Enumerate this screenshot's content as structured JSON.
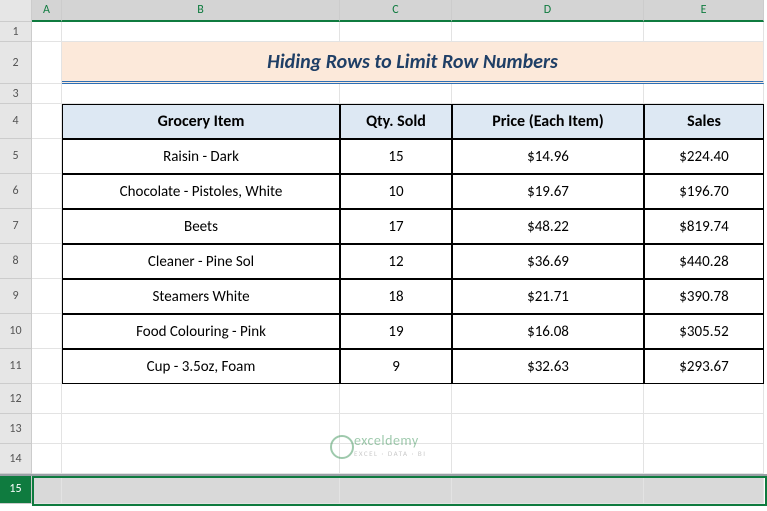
{
  "columns": [
    "A",
    "B",
    "C",
    "D",
    "E"
  ],
  "row_numbers": [
    1,
    2,
    3,
    4,
    5,
    6,
    7,
    8,
    9,
    10,
    11,
    12,
    13,
    14,
    15
  ],
  "selected_row": 15,
  "title": "Hiding Rows to Limit Row Numbers",
  "headers": {
    "item": "Grocery Item",
    "qty": "Qty. Sold",
    "price": "Price (Each Item)",
    "sales": "Sales"
  },
  "data": [
    {
      "item": "Raisin - Dark",
      "qty": "15",
      "price": "$14.96",
      "sales": "$224.40"
    },
    {
      "item": "Chocolate - Pistoles, White",
      "qty": "10",
      "price": "$19.67",
      "sales": "$196.70"
    },
    {
      "item": "Beets",
      "qty": "17",
      "price": "$48.22",
      "sales": "$819.74"
    },
    {
      "item": "Cleaner - Pine Sol",
      "qty": "12",
      "price": "$36.69",
      "sales": "$440.28"
    },
    {
      "item": "Steamers White",
      "qty": "18",
      "price": "$21.71",
      "sales": "$390.78"
    },
    {
      "item": "Food Colouring - Pink",
      "qty": "19",
      "price": "$16.08",
      "sales": "$305.52"
    },
    {
      "item": "Cup - 3.5oz, Foam",
      "qty": "9",
      "price": "$32.63",
      "sales": "$293.67"
    }
  ],
  "watermark": {
    "brand": "exceldemy",
    "tagline": "EXCEL · DATA · BI"
  }
}
